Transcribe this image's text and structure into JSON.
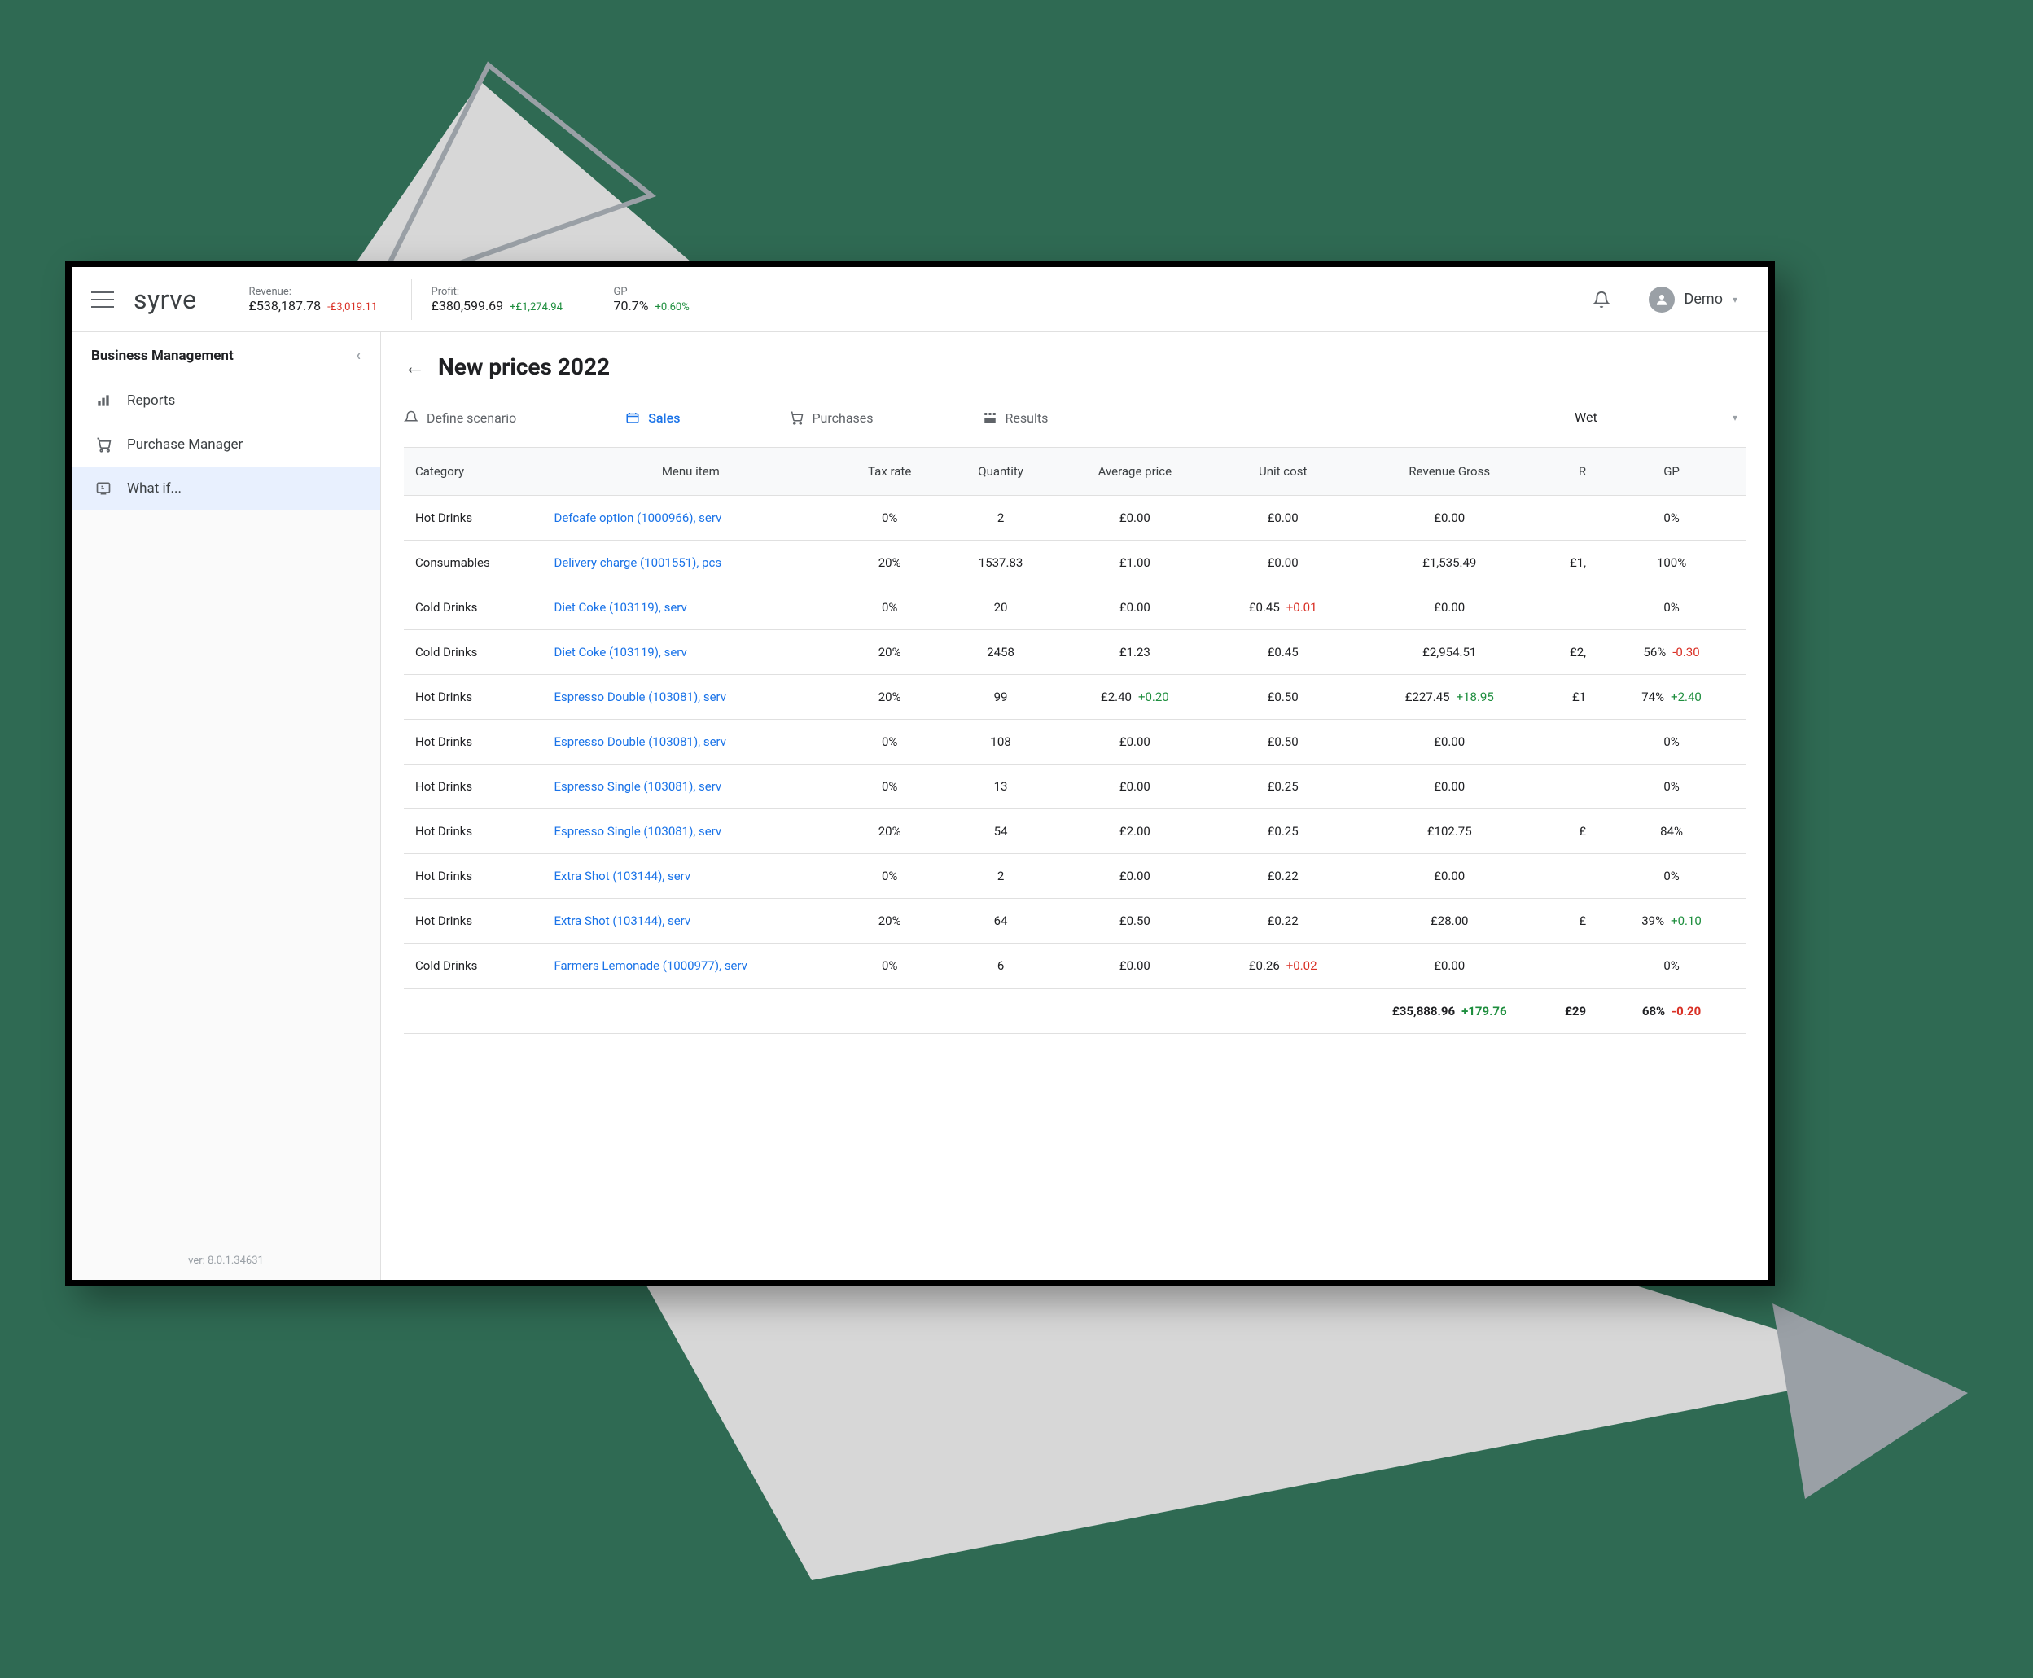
{
  "brand": "syrve",
  "user": {
    "name": "Demo"
  },
  "kpis": [
    {
      "label": "Revenue:",
      "value": "£538,187.78",
      "delta": "-£3,019.11",
      "dir": "neg"
    },
    {
      "label": "Profit:",
      "value": "£380,599.69",
      "delta": "+£1,274.94",
      "dir": "pos"
    },
    {
      "label": "GP",
      "value": "70.7%",
      "delta": "+0.60%",
      "dir": "pos"
    }
  ],
  "sidebar": {
    "section_title": "Business Management",
    "items": [
      {
        "key": "reports",
        "label": "Reports"
      },
      {
        "key": "purchase",
        "label": "Purchase Manager"
      },
      {
        "key": "whatif",
        "label": "What if..."
      }
    ],
    "active_index": 2,
    "version_prefix": "ver:",
    "version": "8.0.1.34631"
  },
  "page": {
    "title": "New prices 2022",
    "tabs": [
      {
        "key": "define",
        "label": "Define scenario"
      },
      {
        "key": "sales",
        "label": "Sales"
      },
      {
        "key": "purchases",
        "label": "Purchases"
      },
      {
        "key": "results",
        "label": "Results"
      }
    ],
    "active_tab_index": 1,
    "filter_selected": "Wet"
  },
  "table": {
    "columns": {
      "category": "Category",
      "menu_item": "Menu item",
      "tax": "Tax rate",
      "qty": "Quantity",
      "avg": "Average price",
      "unit": "Unit cost",
      "rev_gross": "Revenue Gross",
      "rev_net": "R",
      "gp": "GP"
    },
    "rows": [
      {
        "category": "Hot Drinks",
        "menu_item": "Defcafe option (1000966), serv",
        "tax": "0%",
        "qty": "2",
        "avg": "£0.00",
        "avg_delta": "",
        "avg_dir": "",
        "unit": "£0.00",
        "unit_delta": "",
        "unit_dir": "",
        "rev_gross": "£0.00",
        "rev_gross_delta": "",
        "rev_gross_dir": "",
        "rev_net": "",
        "gp": "0%",
        "gp_delta": "",
        "gp_dir": ""
      },
      {
        "category": "Consumables",
        "menu_item": "Delivery charge (1001551), pcs",
        "tax": "20%",
        "qty": "1537.83",
        "avg": "£1.00",
        "avg_delta": "",
        "avg_dir": "",
        "unit": "£0.00",
        "unit_delta": "",
        "unit_dir": "",
        "rev_gross": "£1,535.49",
        "rev_gross_delta": "",
        "rev_gross_dir": "",
        "rev_net": "£1,",
        "gp": "100%",
        "gp_delta": "",
        "gp_dir": ""
      },
      {
        "category": "Cold Drinks",
        "menu_item": "Diet Coke (103119), serv",
        "tax": "0%",
        "qty": "20",
        "avg": "£0.00",
        "avg_delta": "",
        "avg_dir": "",
        "unit": "£0.45",
        "unit_delta": "+0.01",
        "unit_dir": "neg",
        "rev_gross": "£0.00",
        "rev_gross_delta": "",
        "rev_gross_dir": "",
        "rev_net": "",
        "gp": "0%",
        "gp_delta": "",
        "gp_dir": ""
      },
      {
        "category": "Cold Drinks",
        "menu_item": "Diet Coke (103119), serv",
        "tax": "20%",
        "qty": "2458",
        "avg": "£1.23",
        "avg_delta": "",
        "avg_dir": "",
        "unit": "£0.45",
        "unit_delta": "",
        "unit_dir": "",
        "rev_gross": "£2,954.51",
        "rev_gross_delta": "",
        "rev_gross_dir": "",
        "rev_net": "£2,",
        "gp": "56%",
        "gp_delta": "-0.30",
        "gp_dir": "neg"
      },
      {
        "category": "Hot Drinks",
        "menu_item": "Espresso Double (103081), serv",
        "tax": "20%",
        "qty": "99",
        "avg": "£2.40",
        "avg_delta": "+0.20",
        "avg_dir": "pos",
        "unit": "£0.50",
        "unit_delta": "",
        "unit_dir": "",
        "rev_gross": "£227.45",
        "rev_gross_delta": "+18.95",
        "rev_gross_dir": "pos",
        "rev_net": "£1",
        "gp": "74%",
        "gp_delta": "+2.40",
        "gp_dir": "pos"
      },
      {
        "category": "Hot Drinks",
        "menu_item": "Espresso Double (103081), serv",
        "tax": "0%",
        "qty": "108",
        "avg": "£0.00",
        "avg_delta": "",
        "avg_dir": "",
        "unit": "£0.50",
        "unit_delta": "",
        "unit_dir": "",
        "rev_gross": "£0.00",
        "rev_gross_delta": "",
        "rev_gross_dir": "",
        "rev_net": "",
        "gp": "0%",
        "gp_delta": "",
        "gp_dir": ""
      },
      {
        "category": "Hot Drinks",
        "menu_item": "Espresso Single (103081), serv",
        "tax": "0%",
        "qty": "13",
        "avg": "£0.00",
        "avg_delta": "",
        "avg_dir": "",
        "unit": "£0.25",
        "unit_delta": "",
        "unit_dir": "",
        "rev_gross": "£0.00",
        "rev_gross_delta": "",
        "rev_gross_dir": "",
        "rev_net": "",
        "gp": "0%",
        "gp_delta": "",
        "gp_dir": ""
      },
      {
        "category": "Hot Drinks",
        "menu_item": "Espresso Single (103081), serv",
        "tax": "20%",
        "qty": "54",
        "avg": "£2.00",
        "avg_delta": "",
        "avg_dir": "",
        "unit": "£0.25",
        "unit_delta": "",
        "unit_dir": "",
        "rev_gross": "£102.75",
        "rev_gross_delta": "",
        "rev_gross_dir": "",
        "rev_net": "£",
        "gp": "84%",
        "gp_delta": "",
        "gp_dir": ""
      },
      {
        "category": "Hot Drinks",
        "menu_item": "Extra Shot (103144), serv",
        "tax": "0%",
        "qty": "2",
        "avg": "£0.00",
        "avg_delta": "",
        "avg_dir": "",
        "unit": "£0.22",
        "unit_delta": "",
        "unit_dir": "",
        "rev_gross": "£0.00",
        "rev_gross_delta": "",
        "rev_gross_dir": "",
        "rev_net": "",
        "gp": "0%",
        "gp_delta": "",
        "gp_dir": ""
      },
      {
        "category": "Hot Drinks",
        "menu_item": "Extra Shot (103144), serv",
        "tax": "20%",
        "qty": "64",
        "avg": "£0.50",
        "avg_delta": "",
        "avg_dir": "",
        "unit": "£0.22",
        "unit_delta": "",
        "unit_dir": "",
        "rev_gross": "£28.00",
        "rev_gross_delta": "",
        "rev_gross_dir": "",
        "rev_net": "£",
        "gp": "39%",
        "gp_delta": "+0.10",
        "gp_dir": "pos"
      },
      {
        "category": "Cold Drinks",
        "menu_item": "Farmers Lemonade (1000977), serv",
        "tax": "0%",
        "qty": "6",
        "avg": "£0.00",
        "avg_delta": "",
        "avg_dir": "",
        "unit": "£0.26",
        "unit_delta": "+0.02",
        "unit_dir": "neg",
        "rev_gross": "£0.00",
        "rev_gross_delta": "",
        "rev_gross_dir": "",
        "rev_net": "",
        "gp": "0%",
        "gp_delta": "",
        "gp_dir": ""
      }
    ],
    "totals": {
      "rev_gross": "£35,888.96",
      "rev_gross_delta": "+179.76",
      "rev_gross_dir": "pos",
      "rev_net": "£29",
      "gp": "68%",
      "gp_delta": "-0.20",
      "gp_dir": "neg"
    }
  }
}
